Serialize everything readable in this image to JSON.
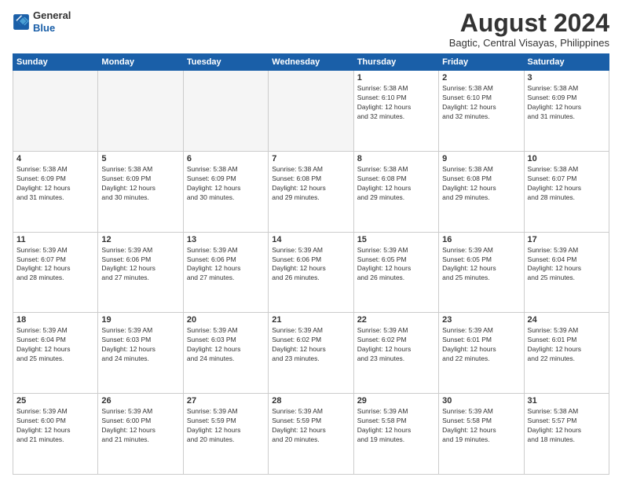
{
  "logo": {
    "line1": "General",
    "line2": "Blue"
  },
  "title": "August 2024",
  "location": "Bagtic, Central Visayas, Philippines",
  "weekdays": [
    "Sunday",
    "Monday",
    "Tuesday",
    "Wednesday",
    "Thursday",
    "Friday",
    "Saturday"
  ],
  "weeks": [
    [
      {
        "day": "",
        "info": ""
      },
      {
        "day": "",
        "info": ""
      },
      {
        "day": "",
        "info": ""
      },
      {
        "day": "",
        "info": ""
      },
      {
        "day": "1",
        "info": "Sunrise: 5:38 AM\nSunset: 6:10 PM\nDaylight: 12 hours\nand 32 minutes."
      },
      {
        "day": "2",
        "info": "Sunrise: 5:38 AM\nSunset: 6:10 PM\nDaylight: 12 hours\nand 32 minutes."
      },
      {
        "day": "3",
        "info": "Sunrise: 5:38 AM\nSunset: 6:09 PM\nDaylight: 12 hours\nand 31 minutes."
      }
    ],
    [
      {
        "day": "4",
        "info": "Sunrise: 5:38 AM\nSunset: 6:09 PM\nDaylight: 12 hours\nand 31 minutes."
      },
      {
        "day": "5",
        "info": "Sunrise: 5:38 AM\nSunset: 6:09 PM\nDaylight: 12 hours\nand 30 minutes."
      },
      {
        "day": "6",
        "info": "Sunrise: 5:38 AM\nSunset: 6:09 PM\nDaylight: 12 hours\nand 30 minutes."
      },
      {
        "day": "7",
        "info": "Sunrise: 5:38 AM\nSunset: 6:08 PM\nDaylight: 12 hours\nand 29 minutes."
      },
      {
        "day": "8",
        "info": "Sunrise: 5:38 AM\nSunset: 6:08 PM\nDaylight: 12 hours\nand 29 minutes."
      },
      {
        "day": "9",
        "info": "Sunrise: 5:38 AM\nSunset: 6:08 PM\nDaylight: 12 hours\nand 29 minutes."
      },
      {
        "day": "10",
        "info": "Sunrise: 5:38 AM\nSunset: 6:07 PM\nDaylight: 12 hours\nand 28 minutes."
      }
    ],
    [
      {
        "day": "11",
        "info": "Sunrise: 5:39 AM\nSunset: 6:07 PM\nDaylight: 12 hours\nand 28 minutes."
      },
      {
        "day": "12",
        "info": "Sunrise: 5:39 AM\nSunset: 6:06 PM\nDaylight: 12 hours\nand 27 minutes."
      },
      {
        "day": "13",
        "info": "Sunrise: 5:39 AM\nSunset: 6:06 PM\nDaylight: 12 hours\nand 27 minutes."
      },
      {
        "day": "14",
        "info": "Sunrise: 5:39 AM\nSunset: 6:06 PM\nDaylight: 12 hours\nand 26 minutes."
      },
      {
        "day": "15",
        "info": "Sunrise: 5:39 AM\nSunset: 6:05 PM\nDaylight: 12 hours\nand 26 minutes."
      },
      {
        "day": "16",
        "info": "Sunrise: 5:39 AM\nSunset: 6:05 PM\nDaylight: 12 hours\nand 25 minutes."
      },
      {
        "day": "17",
        "info": "Sunrise: 5:39 AM\nSunset: 6:04 PM\nDaylight: 12 hours\nand 25 minutes."
      }
    ],
    [
      {
        "day": "18",
        "info": "Sunrise: 5:39 AM\nSunset: 6:04 PM\nDaylight: 12 hours\nand 25 minutes."
      },
      {
        "day": "19",
        "info": "Sunrise: 5:39 AM\nSunset: 6:03 PM\nDaylight: 12 hours\nand 24 minutes."
      },
      {
        "day": "20",
        "info": "Sunrise: 5:39 AM\nSunset: 6:03 PM\nDaylight: 12 hours\nand 24 minutes."
      },
      {
        "day": "21",
        "info": "Sunrise: 5:39 AM\nSunset: 6:02 PM\nDaylight: 12 hours\nand 23 minutes."
      },
      {
        "day": "22",
        "info": "Sunrise: 5:39 AM\nSunset: 6:02 PM\nDaylight: 12 hours\nand 23 minutes."
      },
      {
        "day": "23",
        "info": "Sunrise: 5:39 AM\nSunset: 6:01 PM\nDaylight: 12 hours\nand 22 minutes."
      },
      {
        "day": "24",
        "info": "Sunrise: 5:39 AM\nSunset: 6:01 PM\nDaylight: 12 hours\nand 22 minutes."
      }
    ],
    [
      {
        "day": "25",
        "info": "Sunrise: 5:39 AM\nSunset: 6:00 PM\nDaylight: 12 hours\nand 21 minutes."
      },
      {
        "day": "26",
        "info": "Sunrise: 5:39 AM\nSunset: 6:00 PM\nDaylight: 12 hours\nand 21 minutes."
      },
      {
        "day": "27",
        "info": "Sunrise: 5:39 AM\nSunset: 5:59 PM\nDaylight: 12 hours\nand 20 minutes."
      },
      {
        "day": "28",
        "info": "Sunrise: 5:39 AM\nSunset: 5:59 PM\nDaylight: 12 hours\nand 20 minutes."
      },
      {
        "day": "29",
        "info": "Sunrise: 5:39 AM\nSunset: 5:58 PM\nDaylight: 12 hours\nand 19 minutes."
      },
      {
        "day": "30",
        "info": "Sunrise: 5:39 AM\nSunset: 5:58 PM\nDaylight: 12 hours\nand 19 minutes."
      },
      {
        "day": "31",
        "info": "Sunrise: 5:38 AM\nSunset: 5:57 PM\nDaylight: 12 hours\nand 18 minutes."
      }
    ]
  ]
}
